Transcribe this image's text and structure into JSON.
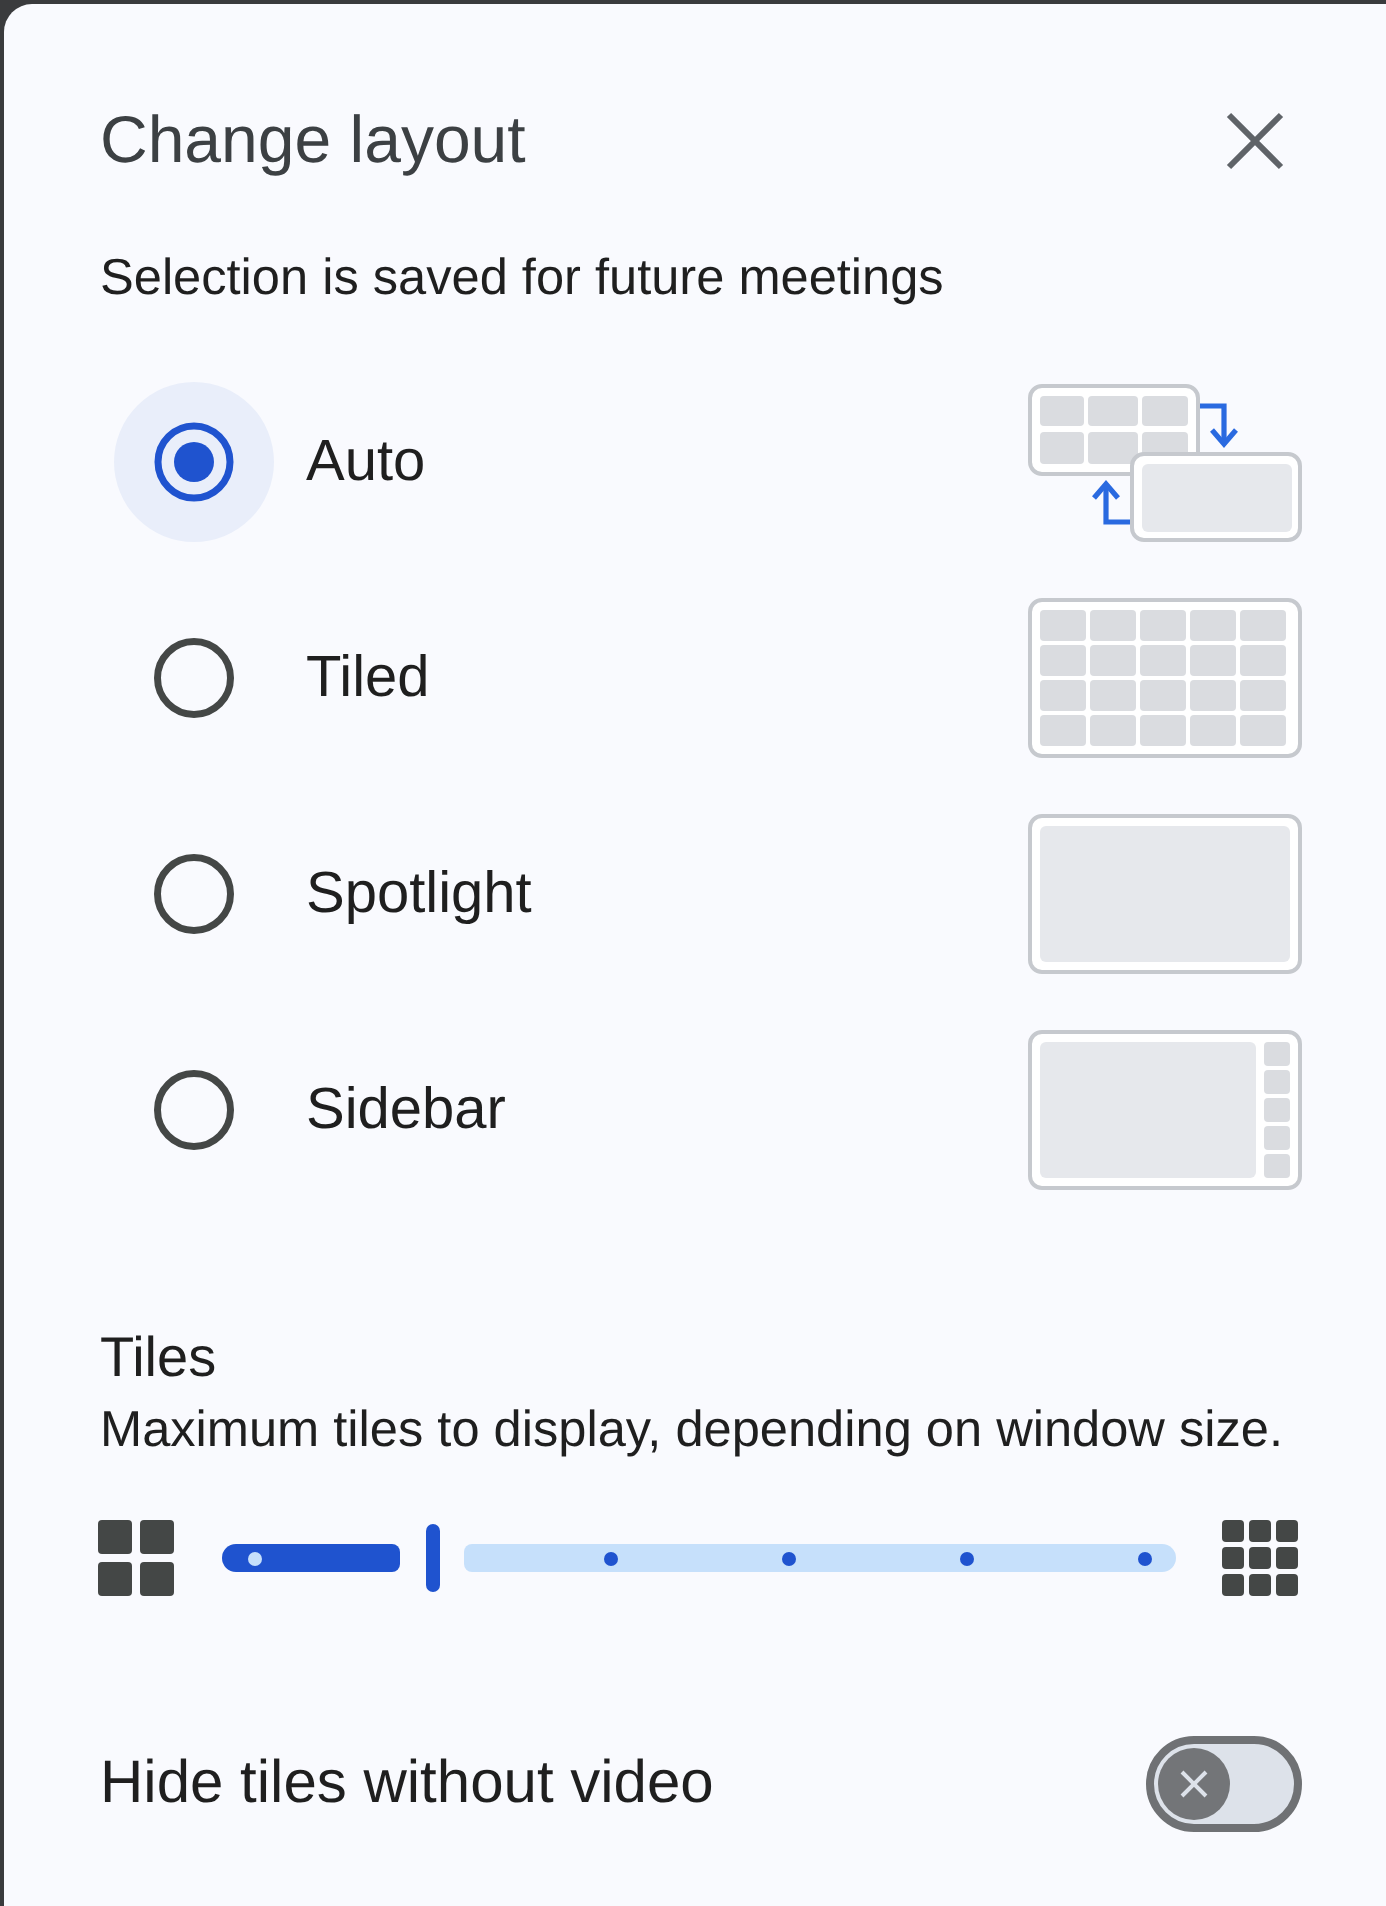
{
  "dialog": {
    "title": "Change layout",
    "subtitle": "Selection is saved for future meetings"
  },
  "layouts": [
    {
      "label": "Auto",
      "kind": "auto",
      "selected": true
    },
    {
      "label": "Tiled",
      "kind": "tiled",
      "selected": false
    },
    {
      "label": "Spotlight",
      "kind": "spotlight",
      "selected": false
    },
    {
      "label": "Sidebar",
      "kind": "sidebar",
      "selected": false
    }
  ],
  "tiles": {
    "heading": "Tiles",
    "description": "Maximum tiles to display, depending on window size.",
    "slider": {
      "level": 0.2
    }
  },
  "hide_tiles": {
    "label": "Hide tiles without video",
    "on": false
  }
}
